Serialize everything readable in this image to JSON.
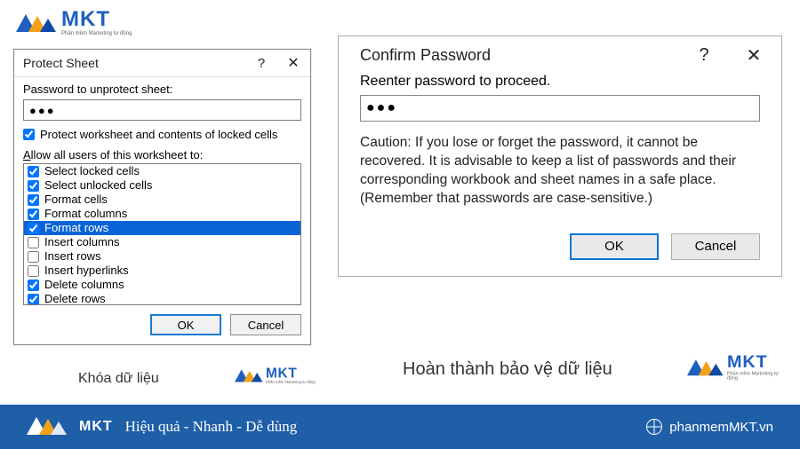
{
  "brand": {
    "name": "MKT",
    "tagline": "Phần mềm Marketing tự động"
  },
  "protect_dialog": {
    "title": "Protect Sheet",
    "password_label": "Password to unprotect sheet:",
    "password_value": "●●●",
    "protect_checkbox_label": "Protect worksheet and contents of locked cells",
    "protect_checked": true,
    "allow_label": "Allow all users of this worksheet to:",
    "permissions": [
      {
        "label": "Select locked cells",
        "checked": true,
        "selected": false
      },
      {
        "label": "Select unlocked cells",
        "checked": true,
        "selected": false
      },
      {
        "label": "Format cells",
        "checked": true,
        "selected": false
      },
      {
        "label": "Format columns",
        "checked": true,
        "selected": false
      },
      {
        "label": "Format rows",
        "checked": true,
        "selected": true
      },
      {
        "label": "Insert columns",
        "checked": false,
        "selected": false
      },
      {
        "label": "Insert rows",
        "checked": false,
        "selected": false
      },
      {
        "label": "Insert hyperlinks",
        "checked": false,
        "selected": false
      },
      {
        "label": "Delete columns",
        "checked": true,
        "selected": false
      },
      {
        "label": "Delete rows",
        "checked": true,
        "selected": false
      }
    ],
    "ok_label": "OK",
    "cancel_label": "Cancel"
  },
  "confirm_dialog": {
    "title": "Confirm Password",
    "reenter_label": "Reenter password to proceed.",
    "password_value": "●●●",
    "caution_text": "Caution: If you lose or forget the password, it cannot be recovered. It is advisable to keep a list of passwords and their corresponding workbook and sheet names in a safe place.  (Remember that passwords are case-sensitive.)",
    "ok_label": "OK",
    "cancel_label": "Cancel"
  },
  "captions": {
    "left": "Khóa dữ liệu",
    "right": "Hoàn thành bảo vệ dữ liệu"
  },
  "footer": {
    "slogan": "Hiệu quả - Nhanh - Dễ dùng",
    "site": "phanmemMKT.vn"
  }
}
